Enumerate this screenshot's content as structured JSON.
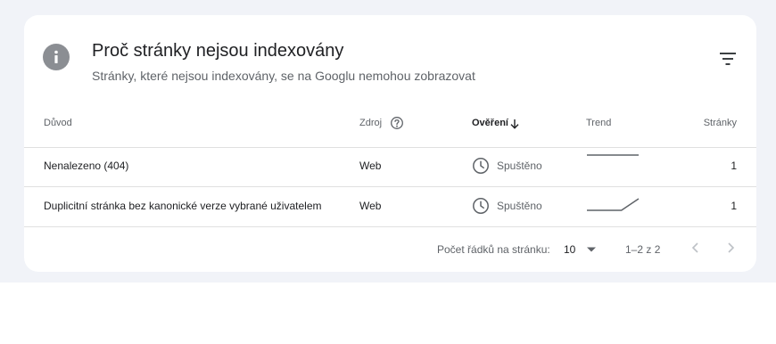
{
  "card": {
    "title": "Proč stránky nejsou indexovány",
    "subtitle": "Stránky, které nejsou indexovány, se na Googlu nemohou zobrazovat"
  },
  "table": {
    "columns": {
      "reason": "Důvod",
      "source": "Zdroj",
      "validation": "Ověření",
      "trend": "Trend",
      "pages": "Stránky"
    },
    "rows": [
      {
        "reason": "Nenalezeno (404)",
        "source": "Web",
        "status": "Spuštěno",
        "trend": [
          5,
          5,
          5,
          5
        ],
        "pages": "1"
      },
      {
        "reason": "Duplicitní stránka bez kanonické verze vybrané uživatelem",
        "source": "Web",
        "status": "Spuštěno",
        "trend": [
          0,
          0,
          0,
          5
        ],
        "pages": "1"
      }
    ]
  },
  "pagination": {
    "rows_per_page_label": "Počet řádků na stránku:",
    "rows_per_page_value": "10",
    "range": "1–2 z 2"
  },
  "icons": {
    "info": "info-icon",
    "filter": "filter-icon",
    "help": "help-icon",
    "sort": "arrow-down-icon",
    "status": "clock-icon",
    "select": "caret-down-icon",
    "prev": "chevron-left-icon",
    "next": "chevron-right-icon"
  },
  "colors": {
    "page_background": "#f1f3f8",
    "card_background": "#ffffff",
    "icon_gray": "#8b8e93",
    "text_primary": "#202124",
    "text_secondary": "#5f6368",
    "divider": "#e0e0e0",
    "sparkline": "#5f6368",
    "disabled": "#bdc1c6"
  }
}
